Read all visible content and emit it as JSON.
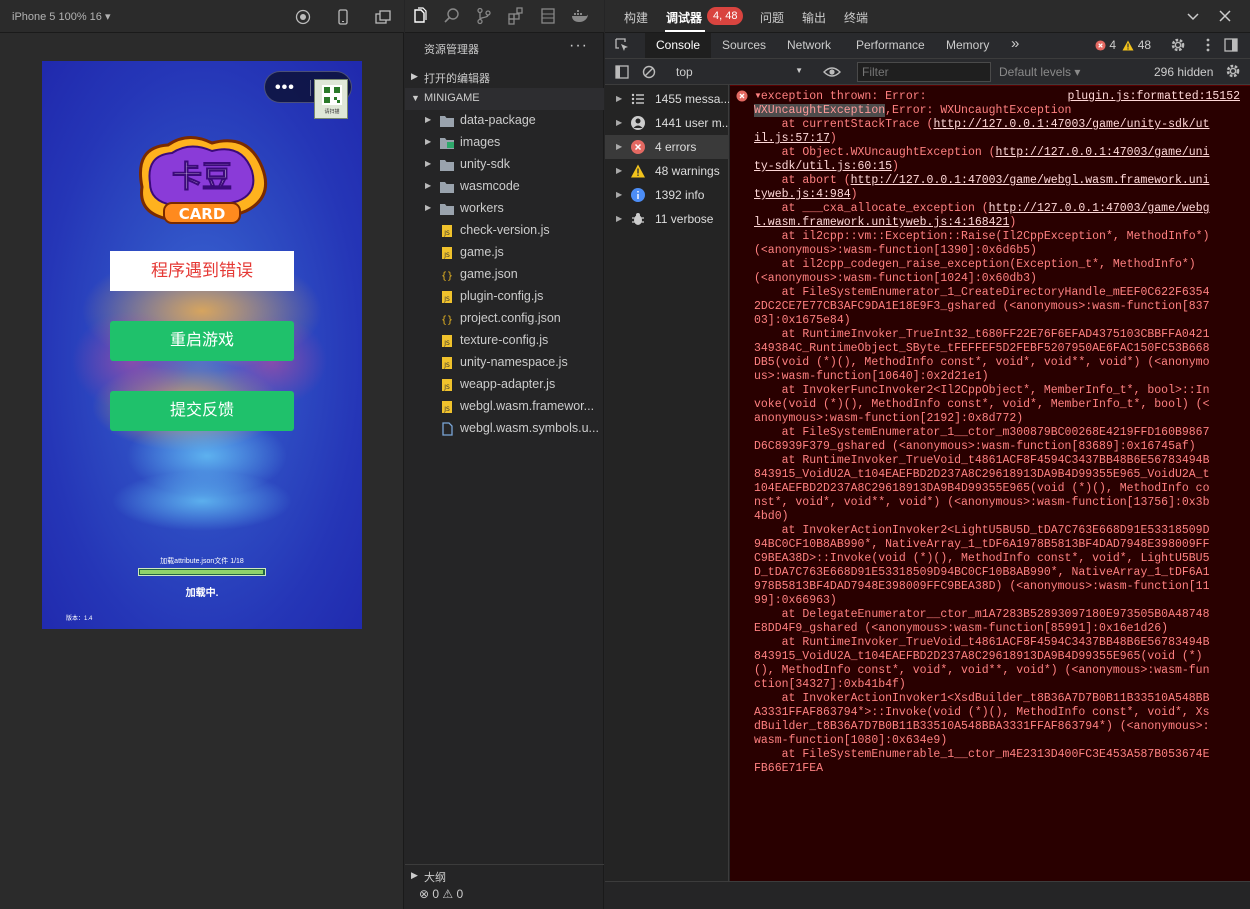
{
  "simulator": {
    "device_label": "iPhone 5 100% 16 ▾",
    "capsule_dots": "•••",
    "qr_label": "请扫描",
    "error_box": "程序遇到错误",
    "restart_button": "重启游戏",
    "feedback_button": "提交反馈",
    "loading_text": "加载attribute.json文件 1/18",
    "loading_fraction": 0.98,
    "loading_label": "加载中.",
    "version": "版本：1.4",
    "logo_text_top": "卡豆",
    "logo_text_bottom": "CARD"
  },
  "explorer": {
    "title": "资源管理器",
    "more": "···",
    "open_editors": "打开的编辑器",
    "project": "MINIGAME",
    "items": [
      {
        "name": "data-package",
        "kind": "folder",
        "icon": "folder-icon"
      },
      {
        "name": "images",
        "kind": "folder",
        "icon": "image-folder-icon"
      },
      {
        "name": "unity-sdk",
        "kind": "folder",
        "icon": "folder-icon"
      },
      {
        "name": "wasmcode",
        "kind": "folder",
        "icon": "folder-icon"
      },
      {
        "name": "workers",
        "kind": "folder",
        "icon": "folder-icon"
      },
      {
        "name": "check-version.js",
        "kind": "js",
        "icon": "js-file-icon"
      },
      {
        "name": "game.js",
        "kind": "js",
        "icon": "js-file-icon"
      },
      {
        "name": "game.json",
        "kind": "json",
        "icon": "json-file-icon"
      },
      {
        "name": "plugin-config.js",
        "kind": "js",
        "icon": "js-file-icon"
      },
      {
        "name": "project.config.json",
        "kind": "json",
        "icon": "json-file-icon"
      },
      {
        "name": "texture-config.js",
        "kind": "js",
        "icon": "js-file-icon"
      },
      {
        "name": "unity-namespace.js",
        "kind": "js",
        "icon": "js-file-icon"
      },
      {
        "name": "weapp-adapter.js",
        "kind": "js",
        "icon": "js-file-icon"
      },
      {
        "name": "webgl.wasm.framewor...",
        "kind": "js",
        "icon": "js-file-icon"
      },
      {
        "name": "webgl.wasm.symbols.u...",
        "kind": "file",
        "icon": "file-icon"
      }
    ],
    "outline": "大纲",
    "status": "⊗ 0 ⚠ 0"
  },
  "topnav": {
    "build": "构建",
    "debugger": "调试器",
    "badge": "4, 48",
    "issues": "问题",
    "output": "输出",
    "terminal": "终端"
  },
  "devtools": {
    "tabs": [
      "Console",
      "Sources",
      "Network",
      "Performance",
      "Memory"
    ],
    "more_tabs": "»",
    "errors": "4",
    "warnings": "48"
  },
  "console_bar": {
    "context": "top",
    "filter_placeholder": "Filter",
    "levels": "Default levels ▾",
    "hidden": "296 hidden"
  },
  "sidebar": [
    {
      "label": "1455 messa...",
      "icon": "list-icon"
    },
    {
      "label": "1441 user m...",
      "icon": "user-icon"
    },
    {
      "label": "4 errors",
      "icon": "error-icon"
    },
    {
      "label": "48 warnings",
      "icon": "warning-icon"
    },
    {
      "label": "1392 info",
      "icon": "info-icon"
    },
    {
      "label": "11 verbose",
      "icon": "bug-icon"
    }
  ],
  "log": {
    "source": "plugin.js:formatted:15152",
    "prefix": "exception thrown: Error:",
    "hidden_text": "WXUncaughtException",
    "after_hidden": ",Error: WXUncaughtException",
    "l1": "    at currentStackTrace (",
    "l1_link": "http://127.0.0.1:47003/game/unity-sdk/util.js:57:17",
    "l2": "    at Object.WXUncaughtException (",
    "l2_link": "http://127.0.0.1:47003/game/unity-sdk/util.js:60:15",
    "l3": "    at abort (",
    "l3_link": "http://127.0.0.1:47003/game/webgl.wasm.framework.unityweb.js:4:984",
    "l4": "    at ___cxa_allocate_exception (",
    "l4_link": "http://127.0.0.1:47003/game/webgl.wasm.framework.unityweb.js:4:168421",
    "rest": "    at il2cpp::vm::Exception::Raise(Il2CppException*, MethodInfo*) (<anonymous>:wasm-function[1390]:0x6d6b5)\n    at il2cpp_codegen_raise_exception(Exception_t*, MethodInfo*) (<anonymous>:wasm-function[1024]:0x60db3)\n    at FileSystemEnumerator_1_CreateDirectoryHandle_mEEF0C622F63542DC2CE7E77CB3AFC9DA1E18E9F3_gshared (<anonymous>:wasm-function[83703]:0x1675e84)\n    at RuntimeInvoker_TrueInt32_t680FF22E76F6EFAD4375103CBBFFA0421349384C_RuntimeObject_SByte_tFEFFEF5D2FEBF5207950AE6FAC150FC53B668DB5(void (*)(), MethodInfo const*, void*, void**, void*) (<anonymous>:wasm-function[10640]:0x2d21e1)\n    at InvokerFuncInvoker2<Il2CppObject*, MemberInfo_t*, bool>::Invoke(void (*)(), MethodInfo const*, void*, MemberInfo_t*, bool) (<anonymous>:wasm-function[2192]:0x8d772)\n    at FileSystemEnumerator_1__ctor_m300879BC00268E4219FFD160B9867D6C8939F379_gshared (<anonymous>:wasm-function[83689]:0x16745af)\n    at RuntimeInvoker_TrueVoid_t4861ACF8F4594C3437BB48B6E56783494B843915_VoidU2A_t104EAEFBD2D237A8C29618913DA9B4D99355E965_VoidU2A_t104EAEFBD2D237A8C29618913DA9B4D99355E965(void (*)(), MethodInfo const*, void*, void**, void*) (<anonymous>:wasm-function[13756]:0x3b4bd0)\n    at InvokerActionInvoker2<LightU5BU5D_tDA7C763E668D91E53318509D94BC0CF10B8AB990*, NativeArray_1_tDF6A1978B5813BF4DAD7948E398009FFC9BEA38D>::Invoke(void (*)(), MethodInfo const*, void*, LightU5BU5D_tDA7C763E668D91E53318509D94BC0CF10B8AB990*, NativeArray_1_tDF6A1978B5813BF4DAD7948E398009FFC9BEA38D) (<anonymous>:wasm-function[1199]:0x66963)\n    at DelegateEnumerator__ctor_m1A7283B52893097180E973505B0A48748E8DD4F9_gshared (<anonymous>:wasm-function[85991]:0x16e1d26)\n    at RuntimeInvoker_TrueVoid_t4861ACF8F4594C3437BB48B6E56783494B843915_VoidU2A_t104EAEFBD2D237A8C29618913DA9B4D99355E965(void (*)(), MethodInfo const*, void*, void**, void*) (<anonymous>:wasm-function[34327]:0xb41b4f)\n    at InvokerActionInvoker1<XsdBuilder_t8B36A7D7B0B11B33510A548BBA3331FFAF863794*>::Invoke(void (*)(), MethodInfo const*, void*, XsdBuilder_t8B36A7D7B0B11B33510A548BBA3331FFAF863794*) (<anonymous>:wasm-function[1080]:0x634e9)\n    at FileSystemEnumerable_1__ctor_m4E2313D400FC3E453A587B053674EFB66E71FEA"
  },
  "colors": {
    "error_bg": "#290000",
    "error_text": "#ff8080",
    "badge_red": "#d9443f",
    "wechat_green": "#1fc16b"
  }
}
